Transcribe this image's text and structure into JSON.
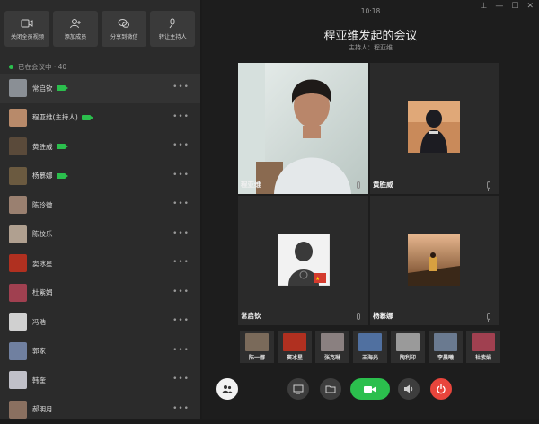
{
  "toolbar": {
    "buttons": [
      {
        "label": "关闭全员视频",
        "icon": "video-off-icon"
      },
      {
        "label": "添加成员",
        "icon": "add-user-icon"
      },
      {
        "label": "分享到微信",
        "icon": "wechat-icon"
      },
      {
        "label": "转让主持人",
        "icon": "mic-icon"
      }
    ]
  },
  "sidebar": {
    "status": "已在会议中 · 40",
    "members": [
      {
        "name": "常启钦",
        "camera": true,
        "color": "#8a8f95"
      },
      {
        "name": "程亚维(主持人)",
        "camera": true,
        "color": "#b88a6a"
      },
      {
        "name": "黄胜威",
        "camera": true,
        "color": "#5a4a3a"
      },
      {
        "name": "杨慕娜",
        "camera": true,
        "color": "#6b5a40"
      },
      {
        "name": "陈玲微",
        "camera": false,
        "color": "#9a8070"
      },
      {
        "name": "陈校乐",
        "camera": false,
        "color": "#b0a090"
      },
      {
        "name": "窦冰星",
        "camera": false,
        "color": "#b03020"
      },
      {
        "name": "杜紫娟",
        "camera": false,
        "color": "#a04050"
      },
      {
        "name": "冯浩",
        "camera": false,
        "color": "#d0d0d0"
      },
      {
        "name": "郭家",
        "camera": false,
        "color": "#7080a0"
      },
      {
        "name": "韩奎",
        "camera": false,
        "color": "#c0c0c8"
      },
      {
        "name": "郝明月",
        "camera": false,
        "color": "#8a7060"
      }
    ]
  },
  "header": {
    "time": "10:18",
    "title": "程亚维发起的会议",
    "host": "主持人：程亚维"
  },
  "tiles": [
    {
      "name": "程亚维"
    },
    {
      "name": "黄胜威"
    },
    {
      "name": "常启钦"
    },
    {
      "name": "杨慕娜"
    }
  ],
  "thumbs": [
    {
      "name": "陈一娜",
      "color": "#7a6a5a"
    },
    {
      "name": "窦冰星",
      "color": "#b03020"
    },
    {
      "name": "张克琳",
      "color": "#8a8080"
    },
    {
      "name": "王海光",
      "color": "#5070a0"
    },
    {
      "name": "陶利印",
      "color": "#9a9a9a"
    },
    {
      "name": "李晨曦",
      "color": "#6a7a90"
    },
    {
      "name": "杜紫娟",
      "color": "#a04050"
    }
  ],
  "controls": {
    "camera_color": "#2bbf4d",
    "hangup_color": "#e8453c"
  }
}
